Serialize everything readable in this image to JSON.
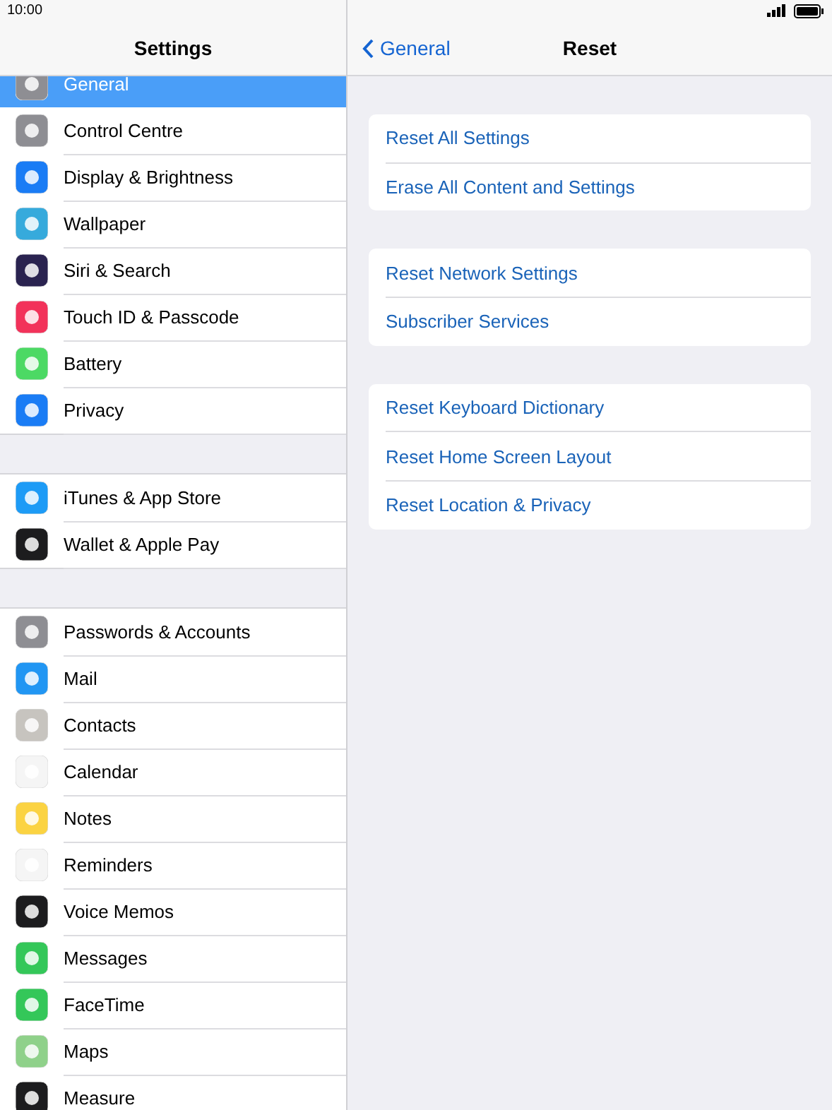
{
  "status_bar": {
    "time": "10:00"
  },
  "sidebar": {
    "title": "Settings",
    "groups": [
      {
        "items": [
          {
            "label": "General",
            "selected": true,
            "color": "#8e8e93"
          },
          {
            "label": "Control Centre",
            "selected": false,
            "color": "#8e8e93"
          },
          {
            "label": "Display & Brightness",
            "selected": false,
            "color": "#1a7cf5"
          },
          {
            "label": "Wallpaper",
            "selected": false,
            "color": "#36aadc"
          },
          {
            "label": "Siri & Search",
            "selected": false,
            "color": "#2a2350"
          },
          {
            "label": "Touch ID & Passcode",
            "selected": false,
            "color": "#f2325a"
          },
          {
            "label": "Battery",
            "selected": false,
            "color": "#4cd964"
          },
          {
            "label": "Privacy",
            "selected": false,
            "color": "#1a7cf5"
          }
        ]
      },
      {
        "items": [
          {
            "label": "iTunes & App Store",
            "selected": false,
            "color": "#1d9bf6"
          },
          {
            "label": "Wallet & Apple Pay",
            "selected": false,
            "color": "#1c1c1e"
          }
        ]
      },
      {
        "items": [
          {
            "label": "Passwords & Accounts",
            "selected": false,
            "color": "#8e8e93"
          },
          {
            "label": "Mail",
            "selected": false,
            "color": "#2196f3"
          },
          {
            "label": "Contacts",
            "selected": false,
            "color": "#c7c4bf"
          },
          {
            "label": "Calendar",
            "selected": false,
            "color": "#f5f5f5"
          },
          {
            "label": "Notes",
            "selected": false,
            "color": "#fbd342"
          },
          {
            "label": "Reminders",
            "selected": false,
            "color": "#f5f5f5"
          },
          {
            "label": "Voice Memos",
            "selected": false,
            "color": "#1c1c1e"
          },
          {
            "label": "Messages",
            "selected": false,
            "color": "#34c759"
          },
          {
            "label": "FaceTime",
            "selected": false,
            "color": "#34c759"
          },
          {
            "label": "Maps",
            "selected": false,
            "color": "#8fd18a"
          },
          {
            "label": "Measure",
            "selected": false,
            "color": "#1c1c1e"
          }
        ]
      }
    ]
  },
  "detail": {
    "back": "General",
    "title": "Reset",
    "groups": [
      [
        "Reset All Settings",
        "Erase All Content and Settings"
      ],
      [
        "Reset Network Settings",
        "Subscriber Services"
      ],
      [
        "Reset Keyboard Dictionary",
        "Reset Home Screen Layout",
        "Reset Location & Privacy"
      ]
    ]
  }
}
